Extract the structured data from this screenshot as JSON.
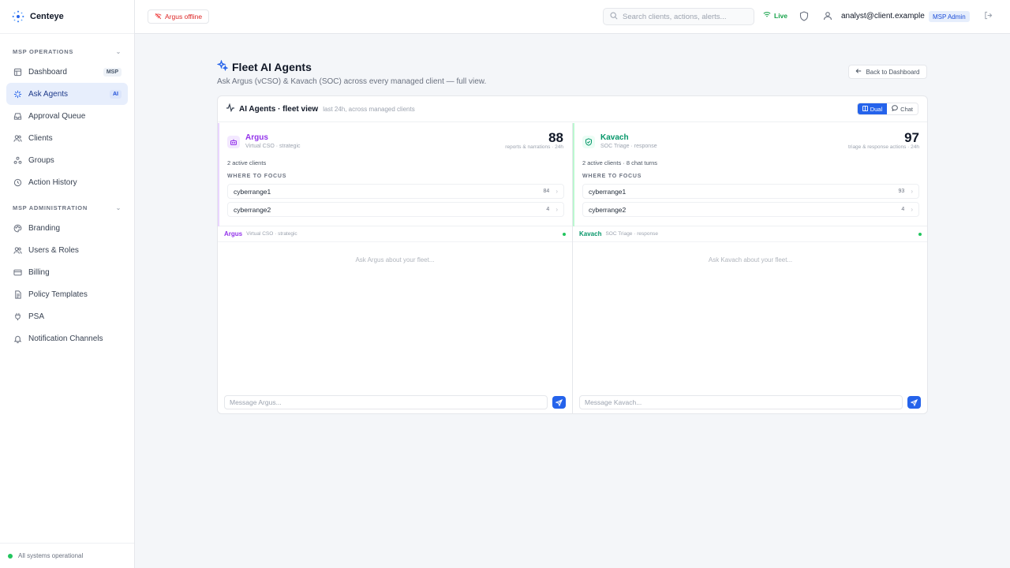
{
  "brand": {
    "name": "Centeye"
  },
  "sidebar": {
    "sections": [
      {
        "title": "MSP OPERATIONS",
        "items": [
          {
            "label": "Dashboard",
            "tag": "MSP",
            "icon": "dashboard-icon"
          },
          {
            "label": "Ask Agents",
            "tag": "AI",
            "icon": "sparkles-icon",
            "active": true
          },
          {
            "label": "Approval Queue",
            "icon": "inbox-icon"
          },
          {
            "label": "Clients",
            "icon": "users-icon"
          },
          {
            "label": "Groups",
            "icon": "groups-icon"
          },
          {
            "label": "Action History",
            "icon": "history-icon"
          }
        ]
      },
      {
        "title": "MSP ADMINISTRATION",
        "items": [
          {
            "label": "Branding",
            "icon": "palette-icon"
          },
          {
            "label": "Users & Roles",
            "icon": "users-roles-icon"
          },
          {
            "label": "Billing",
            "icon": "billing-icon"
          },
          {
            "label": "Policy Templates",
            "icon": "policy-icon"
          },
          {
            "label": "PSA",
            "icon": "plug-icon"
          },
          {
            "label": "Notification Channels",
            "icon": "bell-icon"
          }
        ]
      }
    ],
    "footer": "All systems operational"
  },
  "topbar": {
    "offline_label": "Argus offline",
    "search_placeholder": "Search clients, actions, alerts...",
    "live_label": "Live",
    "user_email": "analyst@client.example",
    "role": "MSP Admin"
  },
  "page": {
    "title": "Fleet AI Agents",
    "subtitle": "Ask Argus (vCSO) & Kavach (SOC) across every managed client — full view.",
    "back_label": "Back to Dashboard"
  },
  "card": {
    "title": "AI Agents · fleet view",
    "meta": "last 24h, across managed clients",
    "toggle": {
      "dual": "Dual",
      "chat": "Chat"
    }
  },
  "agents": {
    "argus": {
      "name": "Argus",
      "role": "Virtual CSO · strategic",
      "count": "88",
      "count_label": "reports & narrations · 24h",
      "stats": "2 active clients",
      "focus_label": "WHERE TO FOCUS",
      "focus": [
        {
          "name": "cyberrange1",
          "value": "84"
        },
        {
          "name": "cyberrange2",
          "value": "4"
        }
      ],
      "chat_name": "Argus",
      "chat_role": "Virtual CSO · strategic",
      "empty": "Ask Argus about your fleet...",
      "placeholder": "Message Argus..."
    },
    "kavach": {
      "name": "Kavach",
      "role": "SOC Triage · response",
      "count": "97",
      "count_label": "triage & response actions · 24h",
      "stats": "2 active clients · 8 chat turns",
      "focus_label": "WHERE TO FOCUS",
      "focus": [
        {
          "name": "cyberrange1",
          "value": "93"
        },
        {
          "name": "cyberrange2",
          "value": "4"
        }
      ],
      "chat_name": "Kavach",
      "chat_role": "SOC Triage · response",
      "empty": "Ask Kavach about your fleet...",
      "placeholder": "Message Kavach..."
    }
  },
  "colors": {
    "accent": "#2563eb",
    "argus": "#9333ea",
    "kavach": "#059669",
    "live": "#16a34a",
    "offline": "#dc2626"
  }
}
